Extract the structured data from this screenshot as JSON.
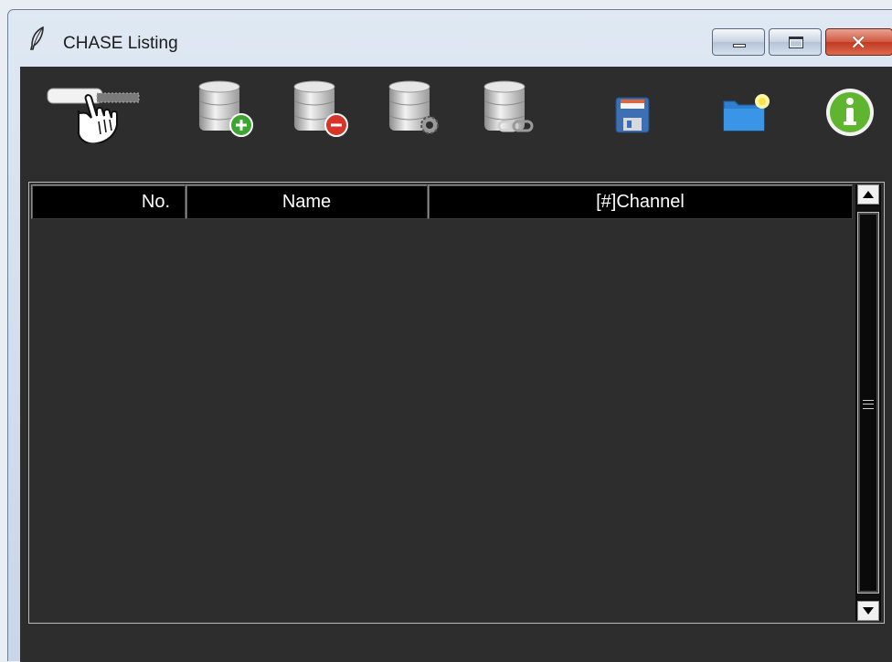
{
  "window": {
    "title": "CHASE Listing",
    "close_glyph": "✕"
  },
  "toolbar": {
    "items": [
      {
        "name": "hand-pointer-icon"
      },
      {
        "name": "database-add-icon"
      },
      {
        "name": "database-remove-icon"
      },
      {
        "name": "database-settings-icon"
      },
      {
        "name": "database-link-icon"
      },
      {
        "name": "floppy-save-icon"
      },
      {
        "name": "folder-open-icon"
      },
      {
        "name": "info-icon"
      }
    ]
  },
  "table": {
    "columns": [
      "No.",
      "Name",
      "[#]Channel"
    ],
    "rows": []
  },
  "colors": {
    "client_bg": "#2d2d2d",
    "header_bg": "#000000",
    "add_green": "#3aa531",
    "remove_red": "#d8342a",
    "info_green": "#5fb52f"
  }
}
